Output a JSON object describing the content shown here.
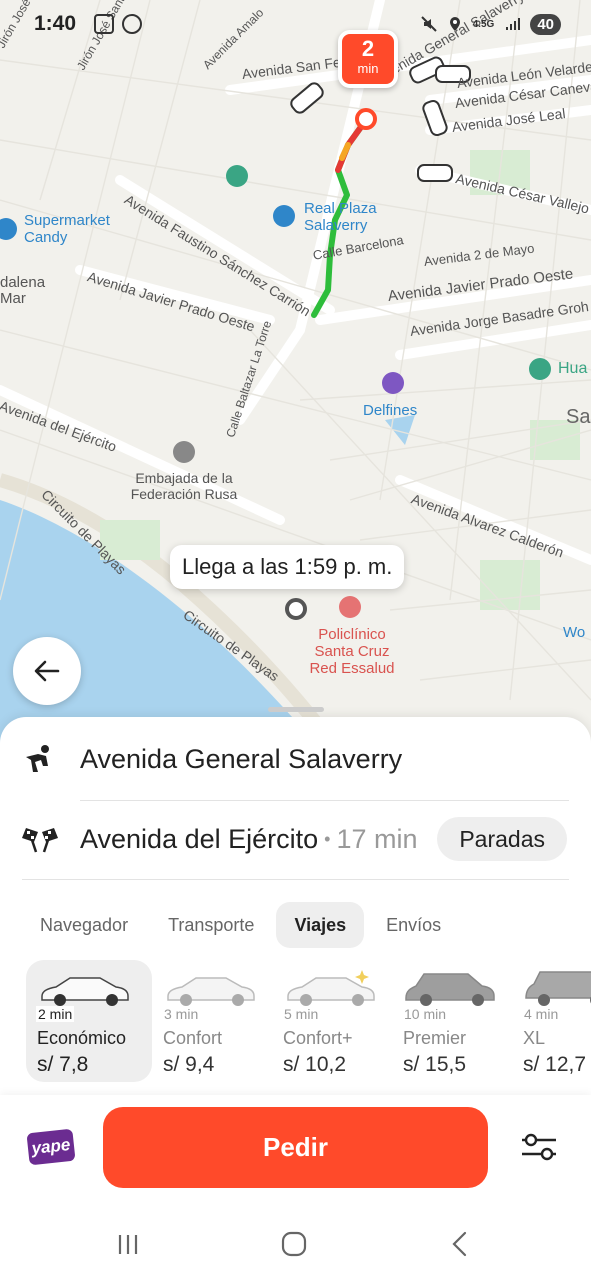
{
  "status_bar": {
    "time": "1:40",
    "network": "4.5G",
    "battery": "40"
  },
  "map": {
    "eta_pin": {
      "value": "2",
      "unit": "min"
    },
    "arrival_text": "Llega a las 1:59 p. m.",
    "streets": [
      "Avenida San Fe",
      "Avenida General Salaverry",
      "Avenida León Velarde",
      "Avenida César Canevaro",
      "Avenida José Leal",
      "Avenida César Vallejo",
      "Avenida Faustino Sánchez Carrión",
      "Calle Barcelona",
      "Avenida 2 de Mayo",
      "Avenida Javier Prado Oeste",
      "Avenida Javier Prado Oeste",
      "Avenida Jorge Basadre Groh",
      "Calle Baltazar La Torre",
      "Avenida del Ejército",
      "Circuito de Playas",
      "Circuito de Playas",
      "Avenida Alvarez Calderón",
      "Jirón José Santiag",
      "Avenida Amalo",
      "Jirón José de"
    ],
    "pois": {
      "supermarket": "Supermarket Candy",
      "plaza": "Real Plaza Salaverry",
      "delfines": "Delfines",
      "embassy": "Embajada de la Federación Rusa",
      "clinic": "Policlínico Santa Cruz Red Essalud",
      "magdalena": "dalena Mar",
      "hua": "Hua",
      "sa": "Sa",
      "wo": "Wo"
    }
  },
  "route": {
    "origin": "Avenida General Salaverry",
    "destination": "Avenida del Ejército",
    "separator": "•",
    "duration": "17 min",
    "stops_label": "Paradas"
  },
  "tabs": [
    {
      "label": "Navegador",
      "active": false
    },
    {
      "label": "Transporte",
      "active": false
    },
    {
      "label": "Viajes",
      "active": true
    },
    {
      "label": "Envíos",
      "active": false
    }
  ],
  "tariffs": [
    {
      "time": "2 min",
      "name": "Económico",
      "price": "s/ 7,8",
      "selected": true
    },
    {
      "time": "3 min",
      "name": "Confort",
      "price": "s/ 9,4",
      "selected": false
    },
    {
      "time": "5 min",
      "name": "Confort+",
      "price": "s/ 10,2",
      "selected": false
    },
    {
      "time": "10 min",
      "name": "Premier",
      "price": "s/ 15,5",
      "selected": false
    },
    {
      "time": "4 min",
      "name": "XL",
      "price": "s/ 12,7",
      "selected": false
    }
  ],
  "payment": {
    "label": "yape"
  },
  "order_button": "Pedir",
  "colors": {
    "accent": "#ff4a2a",
    "route_green": "#2ebd3b",
    "route_red": "#e53935",
    "yape": "#6b2c91"
  }
}
